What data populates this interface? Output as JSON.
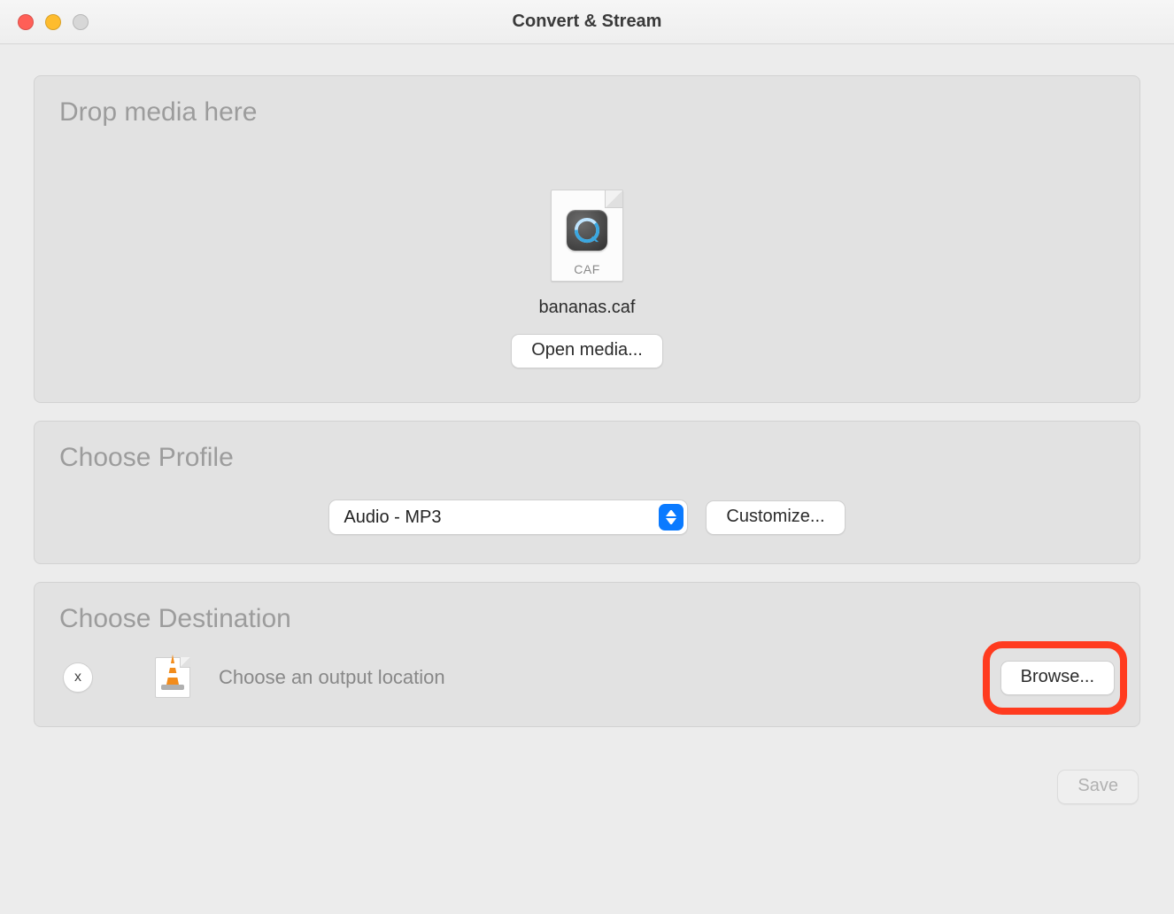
{
  "window": {
    "title": "Convert & Stream"
  },
  "drop": {
    "heading": "Drop media here",
    "file_ext": "CAF",
    "filename": "bananas.caf",
    "open_label": "Open media..."
  },
  "profile": {
    "heading": "Choose Profile",
    "selected": "Audio - MP3",
    "customize_label": "Customize..."
  },
  "destination": {
    "heading": "Choose Destination",
    "clear_label": "x",
    "placeholder": "Choose an output location",
    "browse_label": "Browse..."
  },
  "footer": {
    "save_label": "Save"
  }
}
